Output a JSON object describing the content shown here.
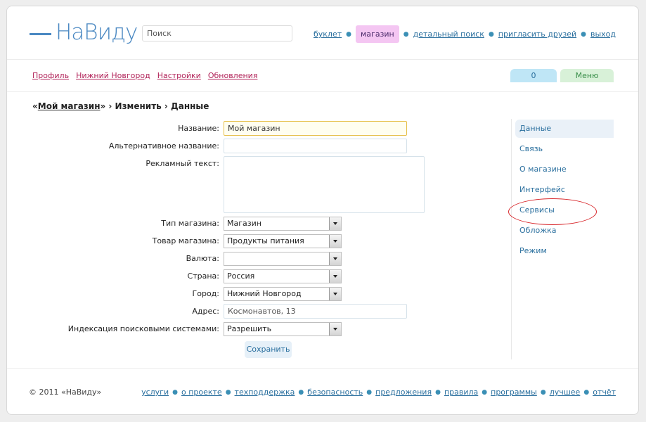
{
  "header": {
    "logo": "НаВиду",
    "search_placeholder": "Поиск",
    "nav": [
      {
        "label": "буклет",
        "active": false
      },
      {
        "label": "магазин",
        "active": true
      },
      {
        "label": "детальный поиск",
        "active": false
      },
      {
        "label": "пригласить друзей",
        "active": false
      },
      {
        "label": "выход",
        "active": false
      }
    ]
  },
  "subnav": [
    "Профиль",
    "Нижний Новгород",
    "Настройки",
    "Обновления"
  ],
  "counter": "0",
  "menu": "Меню",
  "breadcrumb": {
    "open_quote": "«",
    "shop": "Мой магазин",
    "rest": "» › Изменить › Данные"
  },
  "form": {
    "name_label": "Название:",
    "name_value": "Мой магазин",
    "alt_label": "Альтернативное название:",
    "alt_value": "",
    "ad_label": "Рекламный текст:",
    "ad_value": "",
    "type_label": "Тип магазина:",
    "type_value": "Магазин",
    "goods_label": "Товар магазина:",
    "goods_value": "Продукты питания",
    "currency_label": "Валюта:",
    "currency_value": "",
    "country_label": "Страна:",
    "country_value": "Россия",
    "city_label": "Город:",
    "city_value": "Нижний Новгород",
    "address_label": "Адрес:",
    "address_value": "Космонавтов, 13",
    "index_label": "Индексация поисковыми системами:",
    "index_value": "Разрешить",
    "save": "Сохранить"
  },
  "sidebar": {
    "items": [
      {
        "label": "Данные",
        "active": true
      },
      {
        "label": "Связь",
        "active": false
      },
      {
        "label": "О магазине",
        "active": false
      },
      {
        "label": "Интерфейс",
        "active": false
      },
      {
        "label": "Сервисы",
        "active": false,
        "highlighted": true
      },
      {
        "label": "Обложка",
        "active": false
      },
      {
        "label": "Режим",
        "active": false
      }
    ]
  },
  "footer": {
    "copyright": "© 2011 «НаВиду»",
    "links": [
      "услуги",
      "о проекте",
      "техподдержка",
      "безопасность",
      "предложения",
      "правила",
      "программы",
      "лучшее",
      "отчёт"
    ]
  },
  "colors": {
    "link": "#2a6f9e",
    "subnav_link": "#b2245a",
    "active_tab": "#f4c6f2",
    "highlight_ring": "#d8262a"
  }
}
